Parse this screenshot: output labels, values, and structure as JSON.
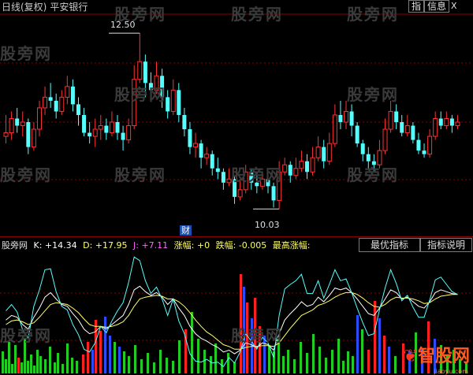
{
  "header": {
    "title": "日线(复权)",
    "stock": "平安银行",
    "btn_index": "指",
    "btn_info": "信息",
    "btn_close": "X"
  },
  "watermark": "股旁网",
  "annotations": {
    "high_label": "12.50",
    "low_label": "10.03",
    "cai_badge": "财"
  },
  "indicator": {
    "name": "股旁网",
    "k_label": "K: +14.34",
    "d_label": "D: +17.95",
    "j_label": "J: +7.11",
    "zf_label": "涨幅: +0",
    "df_label": "跌幅: -0.005",
    "zgzf_label": "最高涨幅:",
    "tab_best": "最优指标",
    "tab_help": "指标说明"
  },
  "logo": {
    "text": "智股网",
    "sub": "jiaoyu.com"
  },
  "colors": {
    "up": "#ff3232",
    "down": "#54ffff",
    "k": "#ffffff",
    "d": "#ffff66",
    "j": "#54ffff",
    "grid": "#8b0000"
  },
  "chart_data": {
    "type": "candlestick",
    "ylim": [
      9.8,
      12.7
    ],
    "annotations": [
      {
        "label": "12.50",
        "value": 12.5
      },
      {
        "label": "10.03",
        "value": 10.03
      }
    ],
    "candles": [
      [
        11.05,
        11.1,
        11.35,
        10.95
      ],
      [
        11.1,
        11.3,
        11.4,
        11.0
      ],
      [
        11.3,
        11.2,
        11.45,
        11.1
      ],
      [
        11.2,
        11.25,
        11.4,
        11.05
      ],
      [
        11.25,
        10.9,
        11.3,
        10.8
      ],
      [
        10.9,
        11.15,
        11.25,
        10.85
      ],
      [
        11.15,
        11.45,
        11.55,
        11.05
      ],
      [
        11.45,
        11.6,
        11.75,
        11.35
      ],
      [
        11.6,
        11.55,
        11.8,
        11.45
      ],
      [
        11.55,
        11.4,
        11.65,
        11.3
      ],
      [
        11.4,
        11.6,
        11.7,
        11.35
      ],
      [
        11.6,
        11.75,
        11.9,
        11.5
      ],
      [
        11.75,
        11.5,
        11.85,
        11.4
      ],
      [
        11.5,
        11.35,
        11.6,
        11.2
      ],
      [
        11.35,
        11.1,
        11.45,
        11.05
      ],
      [
        11.1,
        11.05,
        11.25,
        10.95
      ],
      [
        11.05,
        11.15,
        11.3,
        10.9
      ],
      [
        11.15,
        11.2,
        11.35,
        11.0
      ],
      [
        11.2,
        11.1,
        11.3,
        11.0
      ],
      [
        11.1,
        11.25,
        11.4,
        11.05
      ],
      [
        11.25,
        11.1,
        11.35,
        11.0
      ],
      [
        11.1,
        11.0,
        11.2,
        10.85
      ],
      [
        11.0,
        11.2,
        11.3,
        10.95
      ],
      [
        11.2,
        11.85,
        12.05,
        11.15
      ],
      [
        11.85,
        12.1,
        12.5,
        11.8
      ],
      [
        12.1,
        11.8,
        12.2,
        11.6
      ],
      [
        11.8,
        11.7,
        11.95,
        11.55
      ],
      [
        11.7,
        11.9,
        12.1,
        11.65
      ],
      [
        11.9,
        11.6,
        12.0,
        11.45
      ],
      [
        11.6,
        11.4,
        11.7,
        11.3
      ],
      [
        11.4,
        11.7,
        11.85,
        11.35
      ],
      [
        11.7,
        11.35,
        11.8,
        11.25
      ],
      [
        11.35,
        11.15,
        11.45,
        11.05
      ],
      [
        11.15,
        10.9,
        11.25,
        10.8
      ],
      [
        10.9,
        10.95,
        11.1,
        10.75
      ],
      [
        10.95,
        10.75,
        11.0,
        10.6
      ],
      [
        10.75,
        10.8,
        10.9,
        10.65
      ],
      [
        10.8,
        10.6,
        10.85,
        10.5
      ],
      [
        10.6,
        10.55,
        10.75,
        10.45
      ],
      [
        10.55,
        10.4,
        10.6,
        10.3
      ],
      [
        10.4,
        10.45,
        10.6,
        10.35
      ],
      [
        10.45,
        10.2,
        10.5,
        10.1
      ],
      [
        10.2,
        10.3,
        10.45,
        10.15
      ],
      [
        10.3,
        10.55,
        10.65,
        10.25
      ],
      [
        10.55,
        10.4,
        10.6,
        10.3
      ],
      [
        10.4,
        10.35,
        10.55,
        10.25
      ],
      [
        10.35,
        10.45,
        10.55,
        10.3
      ],
      [
        10.45,
        10.35,
        10.5,
        10.25
      ],
      [
        10.35,
        10.15,
        10.4,
        10.05
      ],
      [
        10.15,
        10.55,
        10.7,
        10.03
      ],
      [
        10.55,
        10.65,
        10.75,
        10.5
      ],
      [
        10.65,
        10.5,
        10.7,
        10.4
      ],
      [
        10.5,
        10.6,
        10.75,
        10.45
      ],
      [
        10.6,
        10.7,
        10.85,
        10.55
      ],
      [
        10.7,
        10.55,
        10.8,
        10.45
      ],
      [
        10.55,
        10.75,
        10.9,
        10.5
      ],
      [
        10.75,
        10.9,
        11.05,
        10.7
      ],
      [
        10.9,
        10.7,
        11.0,
        10.6
      ],
      [
        10.7,
        10.95,
        11.1,
        10.65
      ],
      [
        10.95,
        11.35,
        11.5,
        10.9
      ],
      [
        11.35,
        11.25,
        11.55,
        11.15
      ],
      [
        11.25,
        11.4,
        11.55,
        11.15
      ],
      [
        11.4,
        11.2,
        11.5,
        11.05
      ],
      [
        11.2,
        10.95,
        11.25,
        10.9
      ],
      [
        10.95,
        10.8,
        11.0,
        10.7
      ],
      [
        10.8,
        10.7,
        10.9,
        10.6
      ],
      [
        10.7,
        10.65,
        10.8,
        10.55
      ],
      [
        10.65,
        10.85,
        11.0,
        10.6
      ],
      [
        10.85,
        11.15,
        11.3,
        10.8
      ],
      [
        11.15,
        11.4,
        11.55,
        11.1
      ],
      [
        11.4,
        11.25,
        11.5,
        11.15
      ],
      [
        11.25,
        11.1,
        11.35,
        11.05
      ],
      [
        11.1,
        11.2,
        11.35,
        11.05
      ],
      [
        11.2,
        11.0,
        11.25,
        10.95
      ],
      [
        11.0,
        10.85,
        11.1,
        10.8
      ],
      [
        10.85,
        10.8,
        10.95,
        10.75
      ],
      [
        10.8,
        11.05,
        11.15,
        10.75
      ],
      [
        11.05,
        11.3,
        11.4,
        11.0
      ],
      [
        11.3,
        11.2,
        11.4,
        11.15
      ],
      [
        11.2,
        11.3,
        11.4,
        11.15
      ],
      [
        11.3,
        11.2,
        11.35,
        11.1
      ],
      [
        11.2,
        11.25,
        11.35,
        11.15
      ]
    ],
    "indicator_series": [
      {
        "name": "K",
        "values": [
          55,
          60,
          58,
          50,
          45,
          58,
          68,
          80,
          85,
          78,
          72,
          70,
          62,
          55,
          45,
          40,
          42,
          48,
          45,
          50,
          55,
          60,
          72,
          88,
          92,
          86,
          82,
          85,
          80,
          72,
          78,
          68,
          60,
          48,
          40,
          35,
          32,
          28,
          25,
          20,
          22,
          18,
          22,
          30,
          28,
          25,
          30,
          28,
          22,
          40,
          55,
          62,
          68,
          75,
          70,
          72,
          80,
          75,
          82,
          90,
          88,
          90,
          85,
          78,
          70,
          62,
          60,
          68,
          78,
          88,
          85,
          78,
          80,
          75,
          70,
          68,
          75,
          85,
          88,
          86,
          84,
          83
        ]
      },
      {
        "name": "D",
        "values": [
          50,
          54,
          55,
          53,
          50,
          52,
          58,
          65,
          72,
          74,
          73,
          72,
          68,
          63,
          56,
          50,
          48,
          48,
          47,
          48,
          50,
          53,
          60,
          70,
          78,
          80,
          81,
          82,
          81,
          78,
          78,
          75,
          70,
          63,
          55,
          48,
          42,
          38,
          33,
          28,
          26,
          23,
          23,
          25,
          26,
          26,
          27,
          27,
          26,
          30,
          38,
          46,
          53,
          60,
          63,
          66,
          71,
          73,
          76,
          80,
          83,
          85,
          85,
          83,
          79,
          74,
          70,
          69,
          72,
          77,
          80,
          79,
          79,
          78,
          76,
          73,
          74,
          78,
          81,
          82,
          83,
          83
        ]
      },
      {
        "name": "J",
        "values": [
          65,
          72,
          64,
          44,
          35,
          70,
          88,
          110,
          111,
          86,
          70,
          66,
          50,
          39,
          23,
          20,
          30,
          48,
          41,
          54,
          65,
          74,
          96,
          124,
          120,
          98,
          84,
          91,
          78,
          60,
          78,
          54,
          40,
          18,
          10,
          9,
          12,
          8,
          9,
          4,
          14,
          8,
          20,
          40,
          32,
          23,
          36,
          30,
          14,
          60,
          89,
          94,
          98,
          105,
          84,
          84,
          98,
          79,
          94,
          110,
          98,
          100,
          85,
          68,
          52,
          38,
          40,
          66,
          90,
          110,
          95,
          76,
          82,
          69,
          58,
          58,
          77,
          99,
          102,
          94,
          86,
          83
        ]
      }
    ],
    "volume_bars": [
      [
        2,
        28,
        "g"
      ],
      [
        6,
        18,
        "g"
      ],
      [
        10,
        40,
        "g"
      ],
      [
        14,
        12,
        "g"
      ],
      [
        18,
        36,
        "g"
      ],
      [
        22,
        20,
        "r"
      ],
      [
        26,
        14,
        "g"
      ],
      [
        30,
        44,
        "g"
      ],
      [
        34,
        16,
        "g"
      ],
      [
        38,
        24,
        "g"
      ],
      [
        42,
        10,
        "g"
      ],
      [
        46,
        30,
        "g"
      ],
      [
        50,
        22,
        "g"
      ],
      [
        56,
        18,
        "g"
      ],
      [
        62,
        34,
        "g"
      ],
      [
        68,
        14,
        "g"
      ],
      [
        72,
        26,
        "g"
      ],
      [
        78,
        12,
        "g"
      ],
      [
        84,
        38,
        "g"
      ],
      [
        90,
        20,
        "g"
      ],
      [
        96,
        16,
        "g"
      ],
      [
        104,
        24,
        "r"
      ],
      [
        110,
        40,
        "r"
      ],
      [
        116,
        30,
        "b"
      ],
      [
        120,
        68,
        "r"
      ],
      [
        126,
        54,
        "r"
      ],
      [
        132,
        72,
        "b"
      ],
      [
        138,
        48,
        "b"
      ],
      [
        144,
        40,
        "g"
      ],
      [
        150,
        34,
        "b"
      ],
      [
        156,
        28,
        "g"
      ],
      [
        162,
        22,
        "g"
      ],
      [
        170,
        36,
        "g"
      ],
      [
        178,
        18,
        "g"
      ],
      [
        186,
        26,
        "g"
      ],
      [
        194,
        14,
        "g"
      ],
      [
        202,
        30,
        "g"
      ],
      [
        210,
        20,
        "g"
      ],
      [
        218,
        16,
        "g"
      ],
      [
        226,
        42,
        "g"
      ],
      [
        234,
        56,
        "r"
      ],
      [
        242,
        78,
        "g"
      ],
      [
        250,
        44,
        "g"
      ],
      [
        258,
        30,
        "g"
      ],
      [
        266,
        22,
        "g"
      ],
      [
        272,
        38,
        "g"
      ],
      [
        280,
        18,
        "g"
      ],
      [
        288,
        26,
        "g"
      ],
      [
        296,
        14,
        "g"
      ],
      [
        304,
        126,
        "r"
      ],
      [
        308,
        110,
        "b"
      ],
      [
        312,
        90,
        "r"
      ],
      [
        318,
        70,
        "b"
      ],
      [
        322,
        96,
        "r"
      ],
      [
        328,
        60,
        "r"
      ],
      [
        334,
        48,
        "b"
      ],
      [
        340,
        36,
        "g"
      ],
      [
        346,
        28,
        "g"
      ],
      [
        352,
        44,
        "g"
      ],
      [
        358,
        22,
        "g"
      ],
      [
        364,
        30,
        "g"
      ],
      [
        372,
        18,
        "g"
      ],
      [
        380,
        40,
        "g"
      ],
      [
        388,
        26,
        "g"
      ],
      [
        396,
        50,
        "g"
      ],
      [
        404,
        34,
        "g"
      ],
      [
        412,
        20,
        "g"
      ],
      [
        420,
        30,
        "g"
      ],
      [
        428,
        44,
        "g"
      ],
      [
        434,
        16,
        "g"
      ],
      [
        440,
        28,
        "g"
      ],
      [
        446,
        22,
        "g"
      ],
      [
        452,
        74,
        "b"
      ],
      [
        458,
        56,
        "g"
      ],
      [
        466,
        30,
        "r"
      ],
      [
        474,
        92,
        "r"
      ],
      [
        480,
        70,
        "b"
      ],
      [
        486,
        48,
        "r"
      ],
      [
        492,
        34,
        "b"
      ],
      [
        500,
        22,
        "g"
      ],
      [
        510,
        38,
        "r"
      ],
      [
        518,
        28,
        "b"
      ],
      [
        526,
        52,
        "g"
      ],
      [
        534,
        30,
        "b"
      ],
      [
        542,
        66,
        "r"
      ],
      [
        550,
        44,
        "b"
      ],
      [
        558,
        36,
        "g"
      ],
      [
        566,
        24,
        "g"
      ],
      [
        574,
        30,
        "g"
      ],
      [
        582,
        18,
        "g"
      ],
      [
        590,
        14,
        "g"
      ]
    ]
  }
}
